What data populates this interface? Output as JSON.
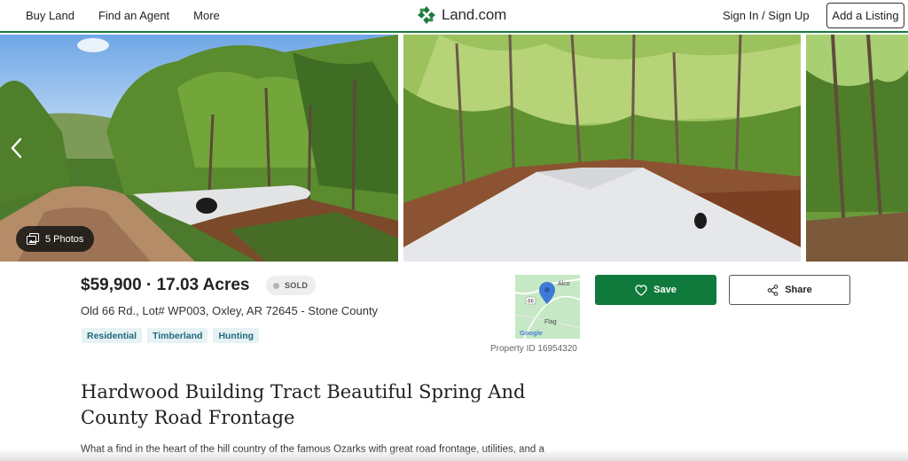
{
  "header": {
    "nav": [
      "Buy Land",
      "Find an Agent",
      "More"
    ],
    "logo_text": "Land.com",
    "logo_icon": "clover-logo-icon",
    "signin": "Sign In  /  Sign Up",
    "add_listing": "Add a Listing"
  },
  "gallery": {
    "photos_count_label": "5 Photos",
    "prev_icon": "chevron-left-icon",
    "photos_icon": "photo-stack-icon"
  },
  "listing": {
    "price_acres": "$59,900 · 17.03 Acres",
    "status": "SOLD",
    "address": "Old 66 Rd., Lot# WP003, Oxley, AR 72645 - Stone County",
    "tags": [
      "Residential",
      "Timberland",
      "Hunting"
    ],
    "property_id": "Property ID 16954320",
    "title": "Hardwood Building Tract Beautiful Spring And County Road Frontage",
    "description": "What a find in the heart of the hill country of the famous Ozarks with great road frontage, utilities, and a"
  },
  "map": {
    "labels": [
      "Alco",
      "66",
      "Flag"
    ],
    "brand": "Google"
  },
  "actions": {
    "save": "Save",
    "share": "Share"
  },
  "colors": {
    "brand_green": "#0f7a3c",
    "tag_bg": "#e6f2f4",
    "tag_text": "#1e6a7a"
  }
}
